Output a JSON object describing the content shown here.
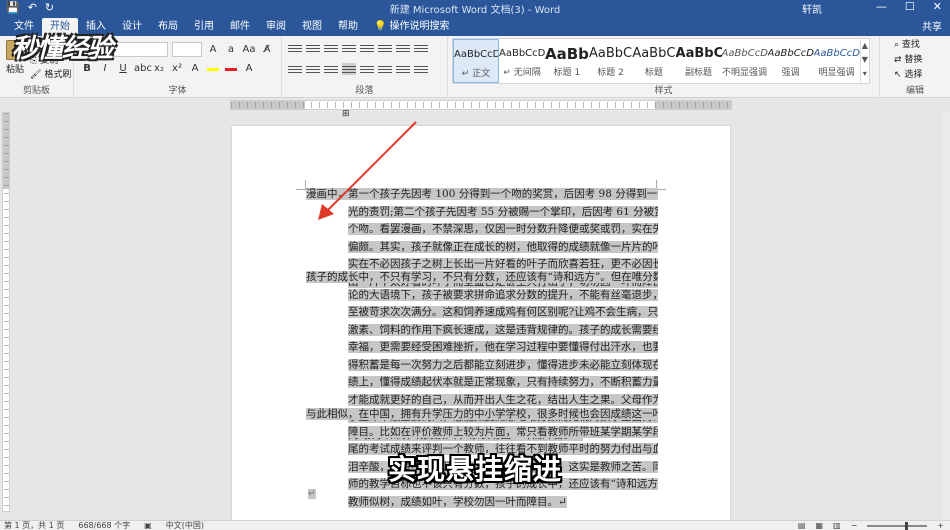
{
  "titlebar": {
    "qat_save": "💾",
    "qat_undo": "↶",
    "qat_redo": "↻",
    "title": "新建 Microsoft Word 文档(3) - Word",
    "user": "轩凯",
    "win_min": "—",
    "win_max": "☐",
    "win_close": "✕"
  },
  "tabs": [
    {
      "label": "文件",
      "active": false
    },
    {
      "label": "开始",
      "active": true
    },
    {
      "label": "插入",
      "active": false
    },
    {
      "label": "设计",
      "active": false
    },
    {
      "label": "布局",
      "active": false
    },
    {
      "label": "引用",
      "active": false
    },
    {
      "label": "邮件",
      "active": false
    },
    {
      "label": "审阅",
      "active": false
    },
    {
      "label": "视图",
      "active": false
    },
    {
      "label": "帮助",
      "active": false
    }
  ],
  "tell_me": "操作说明搜索",
  "share": "共享",
  "ribbon": {
    "paste_label": "粘贴",
    "copy_label": "复制",
    "format_painter_label": "格式刷",
    "clipboard_group": "剪贴板",
    "font_group": "字体",
    "paragraph_group": "段落",
    "styles_group": "样式",
    "editing_group": "编辑",
    "styles": [
      {
        "sample": "AaBbCcDd",
        "name": "↵ 正文",
        "selected": true
      },
      {
        "sample": "AaBbCcDd",
        "name": "↵ 无间隔",
        "selected": false
      },
      {
        "sample": "AaBb",
        "name": "标题 1",
        "selected": false
      },
      {
        "sample": "AaBbC",
        "name": "标题 2",
        "selected": false
      },
      {
        "sample": "AaBbC",
        "name": "标题",
        "selected": false
      },
      {
        "sample": "AaBbC",
        "name": "副标题",
        "selected": false
      },
      {
        "sample": "AaBbCcDd",
        "name": "不明显强调",
        "selected": false
      },
      {
        "sample": "AaBbCcDd",
        "name": "强调",
        "selected": false
      },
      {
        "sample": "AaBbCcDd",
        "name": "明显强调",
        "selected": false
      }
    ],
    "find_label": "查找",
    "replace_label": "替换",
    "select_label": "选择"
  },
  "document": {
    "p1_lines": [
      "漫画中，第一个孩子先因考 100 分得到一个吻的奖赏，后因考 98 分得到一个耳",
      "光的责罚;第二个孩子先因考 55 分被赐一个掌印，后因考 61 分被赏一",
      "个吻。看罢漫画，不禁深思，仅因一时分数升降便或奖或罚，实在失之",
      "偏颇。其实，孩子就像正在成长的树，他取得的成绩就像一片片的叶子，",
      "实在不必因孩子之树上长出一片好看的叶子而欣喜若狂，更不必因长",
      "出一片不太好看的叶子而全盘否定甚至大打出手，切勿因一叶而障目。↵"
    ],
    "p2_lines": [
      "孩子的成长中，不只有学习，不只有分数，还应该有“诗和远方”。但在唯分数",
      "论的大语境下，孩子被要求拼命追求分数的提升，不能有丝毫退步，甚",
      "至被苛求次次满分。这和饲养速成鸡有何区别呢?让鸡不会生病，只在",
      "激素、饲料的作用下疯长速成，这是违背规律的。孩子的成长需要经历",
      "幸福，更需要经受困难挫折，他在学习过程中要懂得付出汗水，也要懂",
      "得积蓄是每一次努力之后都能立刻进步，懂得进步未必能立刻体现在成",
      "绩上，懂得成绩起伏本就是正常现象，只有持续努力，不断积蓄力量，",
      "才能成就更好的自己，从而开出人生之花，结出人生之果。父母作为孩",
      "子生命中最重要的人，怎能如此随意地唯分数而无视对孩子全面的评",
      "判?孩子似树，成绩如叶，家长勿因一叶而障目。↵"
    ],
    "p3_lines": [
      "与此相似，在中国，拥有升学压力的中小学学校，很多时候也会因成绩这一叶而",
      "障目。比如在评价教师上较为片面，常只看教师所带班某学期某学段末",
      "尾的考试成绩来评判一个教师，往往看不到教师平时的努力付出与血",
      "泪辛酸，更看不到教师在教学中的进步与成长，这实是教师之苦。同样的，教",
      "师的教学目标也不该只有分数，孩子的成长中，还应该有“诗和远方”。",
      "教师似树，成绩如叶，学校勿因一叶而障目。↵"
    ],
    "end_mark": "↵"
  },
  "caption": "实现悬挂缩进",
  "logo": "秒懂经验",
  "status": {
    "page": "第 1 页，共 1 页",
    "words": "668/668 个字",
    "language": "中文(中国)"
  },
  "colors": {
    "accent": "#2b579a",
    "selection": "#c6c6c6",
    "arrow": "#e03a2a"
  }
}
